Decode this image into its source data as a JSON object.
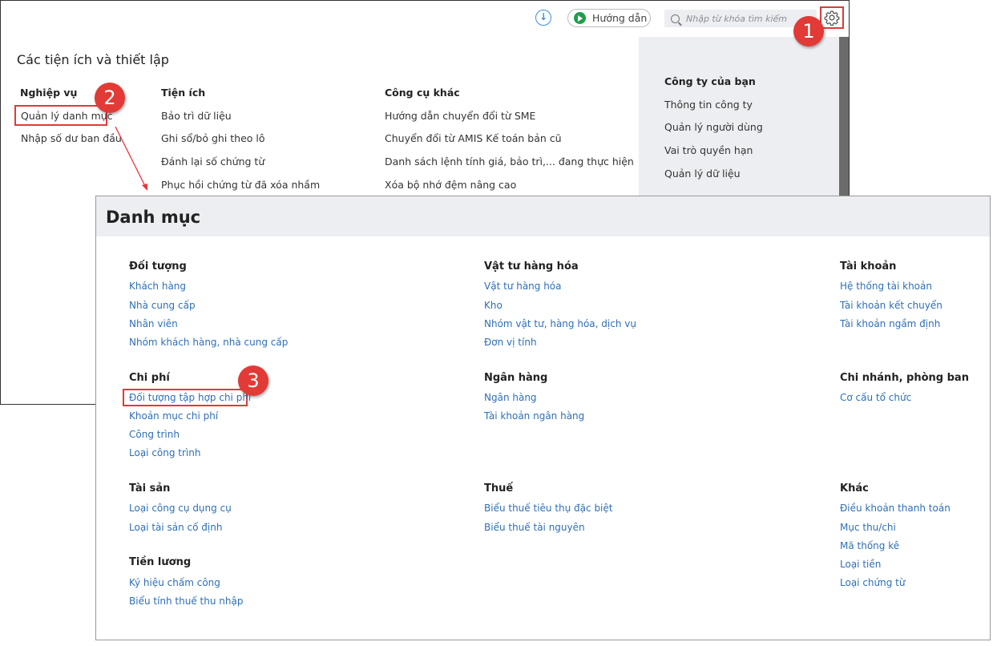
{
  "toolbar": {
    "download_icon": "download-circle-icon",
    "help_label": "Hướng dẫn",
    "search_placeholder": "Nhập từ khóa tìm kiếm",
    "settings_icon": "gear-icon"
  },
  "settings": {
    "title": "Các tiện ích và thiết lập",
    "columns": {
      "nghiep_vu": {
        "heading": "Nghiệp vụ",
        "items": [
          "Quản lý danh mục",
          "Nhập số dư ban đầu"
        ]
      },
      "tien_ich": {
        "heading": "Tiện ích",
        "items": [
          "Bảo trì dữ liệu",
          "Ghi sổ/bỏ ghi theo lô",
          "Đánh lại số chứng từ",
          "Phục hồi chứng từ đã xóa nhầm"
        ]
      },
      "cong_cu_khac": {
        "heading": "Công cụ khác",
        "items": [
          "Hướng dẫn chuyển đổi từ SME",
          "Chuyển đổi từ AMIS Kế toán bản cũ",
          "Danh sách lệnh tính giá, bảo trì,... đang thực hiện",
          "Xóa bộ nhớ đệm nâng cao"
        ]
      }
    },
    "company_card": {
      "heading": "Công ty của bạn",
      "items": [
        "Thông tin công ty",
        "Quản lý người dùng",
        "Vai trò quyền hạn",
        "Quản lý dữ liệu"
      ]
    }
  },
  "badges": [
    "1",
    "2",
    "3"
  ],
  "danh_muc": {
    "title": "Danh mục",
    "groups": {
      "doi_tuong": {
        "heading": "Đối tượng",
        "items": [
          "Khách hàng",
          "Nhà cung cấp",
          "Nhân viên",
          "Nhóm khách hàng, nhà cung cấp"
        ]
      },
      "vat_tu": {
        "heading": "Vật tư hàng hóa",
        "items": [
          "Vật tư hàng hóa",
          "Kho",
          "Nhóm vật tư, hàng hóa, dịch vụ",
          "Đơn vị tính"
        ]
      },
      "tai_khoan": {
        "heading": "Tài khoản",
        "items": [
          "Hệ thống tài khoản",
          "Tài khoản kết chuyển",
          "Tài khoản ngầm định"
        ]
      },
      "chi_phi": {
        "heading": "Chi phí",
        "items": [
          "Đối tượng tập hợp chi phí",
          "Khoản mục chi phí",
          "Công trình",
          "Loại công trình"
        ]
      },
      "ngan_hang": {
        "heading": "Ngân hàng",
        "items": [
          "Ngân hàng",
          "Tài khoản ngân hàng"
        ]
      },
      "chi_nhanh": {
        "heading": "Chi nhánh, phòng ban",
        "items": [
          "Cơ cấu tổ chức"
        ]
      },
      "tai_san": {
        "heading": "Tài sản",
        "items": [
          "Loại công cụ dụng cụ",
          "Loại tài sản cố định"
        ]
      },
      "thue": {
        "heading": "Thuế",
        "items": [
          "Biểu thuế tiêu thụ đặc biệt",
          "Biểu thuế tài nguyên"
        ]
      },
      "khac": {
        "heading": "Khác",
        "items": [
          "Điều khoản thanh toán",
          "Mục thu/chi",
          "Mã thống kê",
          "Loại tiền",
          "Loại chứng từ"
        ]
      },
      "tien_luong": {
        "heading": "Tiền lương",
        "items": [
          "Ký hiệu chấm công",
          "Biểu tính thuế thu nhập"
        ]
      }
    }
  },
  "colors": {
    "highlight": "#e03a3a",
    "badge": "#e23a36",
    "link": "#2e6fb7",
    "panel_bg": "#eceef1"
  }
}
